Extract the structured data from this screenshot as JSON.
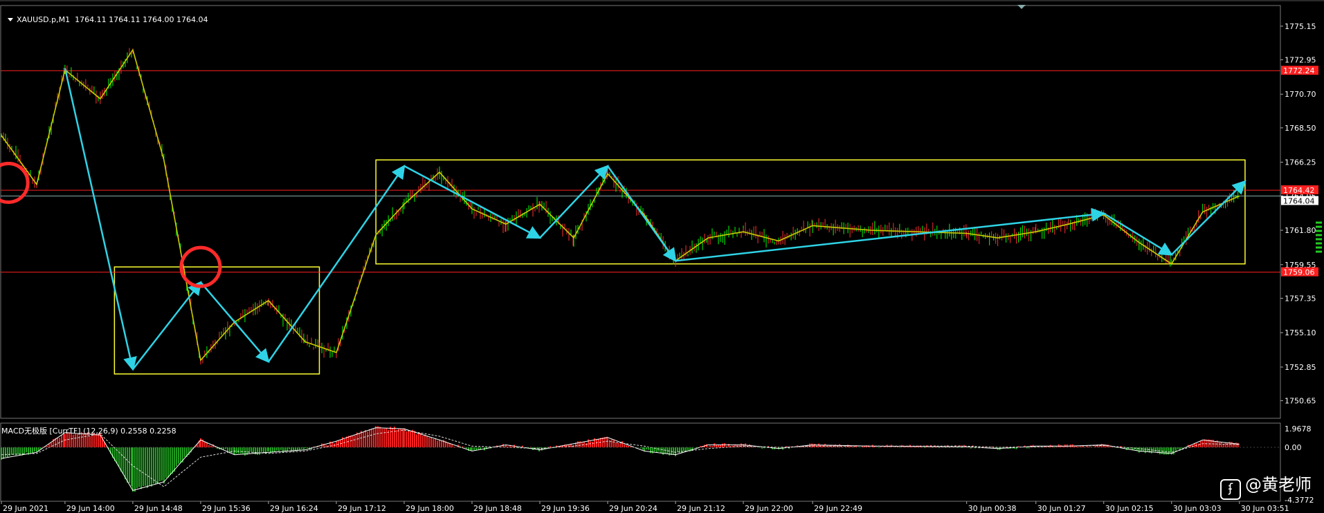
{
  "window": {
    "symbol_label": "XAUUSD.p,M1",
    "ohlc_label": "1764.11 1764.11 1764.00 1764.04"
  },
  "indicator": {
    "label": "MACD无极版 [CurrTF] (12,26,9) 0.2558 0.2258"
  },
  "watermark": {
    "text": "@黄老师"
  },
  "colors": {
    "background": "#000000",
    "price_line": "#cccc00",
    "candle_up": "#00ff00",
    "candle_down": "#ff3030",
    "arrow": "#2fd3e6",
    "zone_box": "#ffff33",
    "level_line": "#ff2020",
    "circle": "#ff2a2a",
    "macd_pos": "#ff2020",
    "macd_neg": "#22aa22",
    "axis_text": "#ffffff"
  },
  "chart_data": [
    {
      "type": "line",
      "name": "XAUUSD.p,M1 price",
      "x": [
        "29 Jun 13:15",
        "29 Jun 13:40",
        "29 Jun 14:00",
        "29 Jun 14:25",
        "29 Jun 14:48",
        "29 Jun 15:10",
        "29 Jun 15:36",
        "29 Jun 16:00",
        "29 Jun 16:24",
        "29 Jun 16:50",
        "29 Jun 17:12",
        "29 Jun 17:40",
        "29 Jun 18:00",
        "29 Jun 18:25",
        "29 Jun 18:48",
        "29 Jun 19:12",
        "29 Jun 19:36",
        "29 Jun 20:00",
        "29 Jun 20:24",
        "29 Jun 20:50",
        "29 Jun 21:12",
        "29 Jun 21:35",
        "29 Jun 22:00",
        "29 Jun 22:25",
        "29 Jun 22:49",
        "29 Jun 23:30",
        "30 Jun 00:38",
        "30 Jun 01:00",
        "30 Jun 01:27",
        "30 Jun 01:50",
        "30 Jun 02:15",
        "30 Jun 02:40",
        "30 Jun 03:03",
        "30 Jun 03:25",
        "30 Jun 03:51"
      ],
      "y": [
        1768.0,
        1764.8,
        1772.3,
        1770.4,
        1773.6,
        1766.4,
        1753.3,
        1755.8,
        1757.2,
        1754.5,
        1753.8,
        1761.5,
        1763.5,
        1765.6,
        1763.2,
        1762.2,
        1763.5,
        1761.3,
        1765.5,
        1762.8,
        1759.8,
        1761.3,
        1761.7,
        1761.1,
        1762.1,
        1761.8,
        1761.6,
        1761.3,
        1761.7,
        1762.2,
        1762.8,
        1761.0,
        1759.6,
        1763.0,
        1764.04
      ],
      "ylim": [
        1749.5,
        1776.5
      ],
      "y_ticks": [
        "1775.15",
        "1772.95",
        "1770.70",
        "1768.50",
        "1766.25",
        "1764.05",
        "1761.80",
        "1759.55",
        "1757.35",
        "1755.10",
        "1752.85",
        "1750.65"
      ],
      "x_ticks": [
        "29 Jun 2021",
        "29 Jun 14:00",
        "29 Jun 14:48",
        "29 Jun 15:36",
        "29 Jun 16:24",
        "29 Jun 17:12",
        "29 Jun 18:00",
        "29 Jun 18:48",
        "29 Jun 19:36",
        "29 Jun 20:24",
        "29 Jun 21:12",
        "29 Jun 22:00",
        "29 Jun 22:49",
        "30 Jun 00:38",
        "30 Jun 01:27",
        "30 Jun 02:15",
        "30 Jun 03:03",
        "30 Jun 03:51"
      ],
      "price_levels": [
        {
          "value": 1772.24,
          "label": "1772.24",
          "color": "#ff2020"
        },
        {
          "value": 1764.42,
          "label": "1764.42",
          "color": "#ff2020"
        },
        {
          "value": 1764.04,
          "label": "1764.04",
          "color": "#ffffff"
        },
        {
          "value": 1759.06,
          "label": "1759.06",
          "color": "#ff2020"
        }
      ],
      "zones": [
        {
          "from": "29 Jun 14:35",
          "to": "29 Jun 17:00",
          "top": 1759.4,
          "bottom": 1752.4
        },
        {
          "from": "29 Jun 17:40",
          "to": "30 Jun 03:55",
          "top": 1766.4,
          "bottom": 1759.6
        }
      ],
      "wave_arrows": [
        {
          "from": {
            "x": "29 Jun 14:00",
            "y": 1772.4
          },
          "to": {
            "x": "29 Jun 14:48",
            "y": 1752.7
          }
        },
        {
          "from": {
            "x": "29 Jun 14:48",
            "y": 1752.7
          },
          "to": {
            "x": "29 Jun 15:36",
            "y": 1758.4
          }
        },
        {
          "from": {
            "x": "29 Jun 15:36",
            "y": 1758.4
          },
          "to": {
            "x": "29 Jun 16:24",
            "y": 1753.2
          }
        },
        {
          "from": {
            "x": "29 Jun 16:24",
            "y": 1753.2
          },
          "to": {
            "x": "29 Jun 18:00",
            "y": 1766.0
          }
        },
        {
          "from": {
            "x": "29 Jun 18:00",
            "y": 1766.0
          },
          "to": {
            "x": "29 Jun 19:36",
            "y": 1761.3
          }
        },
        {
          "from": {
            "x": "29 Jun 19:36",
            "y": 1761.3
          },
          "to": {
            "x": "29 Jun 20:24",
            "y": 1766.0
          }
        },
        {
          "from": {
            "x": "29 Jun 20:24",
            "y": 1766.0
          },
          "to": {
            "x": "29 Jun 21:12",
            "y": 1759.8
          }
        },
        {
          "from": {
            "x": "29 Jun 21:12",
            "y": 1759.8
          },
          "to": {
            "x": "30 Jun 02:15",
            "y": 1762.9
          }
        },
        {
          "from": {
            "x": "30 Jun 02:15",
            "y": 1762.9
          },
          "to": {
            "x": "30 Jun 03:03",
            "y": 1760.2
          }
        },
        {
          "from": {
            "x": "30 Jun 03:03",
            "y": 1760.2
          },
          "to": {
            "x": "30 Jun 03:55",
            "y": 1765.0
          }
        }
      ],
      "circle_marks": [
        {
          "x": "29 Jun 13:20",
          "y": 1764.9
        },
        {
          "x": "29 Jun 15:36",
          "y": 1759.4
        }
      ]
    },
    {
      "type": "bar",
      "name": "MACD无极版 [CurrTF] (12,26,9)",
      "ylim": [
        -4.3772,
        1.9678
      ],
      "y_ticks": [
        "1.9678",
        "0.00",
        "-4.3772"
      ],
      "x": [
        "29 Jun 13:15",
        "29 Jun 13:40",
        "29 Jun 14:00",
        "29 Jun 14:25",
        "29 Jun 14:48",
        "29 Jun 15:10",
        "29 Jun 15:36",
        "29 Jun 16:00",
        "29 Jun 16:24",
        "29 Jun 16:50",
        "29 Jun 17:12",
        "29 Jun 17:40",
        "29 Jun 18:00",
        "29 Jun 18:25",
        "29 Jun 18:48",
        "29 Jun 19:12",
        "29 Jun 19:36",
        "29 Jun 20:00",
        "29 Jun 20:24",
        "29 Jun 20:50",
        "29 Jun 21:12",
        "29 Jun 21:35",
        "29 Jun 22:00",
        "29 Jun 22:25",
        "29 Jun 22:49",
        "29 Jun 23:30",
        "30 Jun 00:38",
        "30 Jun 01:00",
        "30 Jun 01:27",
        "30 Jun 01:50",
        "30 Jun 02:15",
        "30 Jun 02:40",
        "30 Jun 03:03",
        "30 Jun 03:25",
        "30 Jun 03:51"
      ],
      "values": [
        -0.9,
        -0.4,
        1.2,
        1.0,
        -3.5,
        -2.8,
        0.6,
        -0.6,
        -0.4,
        -0.2,
        0.5,
        1.6,
        1.5,
        0.6,
        -0.3,
        0.2,
        -0.2,
        0.3,
        0.8,
        -0.3,
        -0.6,
        0.2,
        0.2,
        -0.1,
        0.2,
        0.1,
        0.05,
        -0.1,
        0.1,
        0.1,
        0.2,
        -0.3,
        -0.5,
        0.6,
        0.2558
      ],
      "signal": [
        -0.6,
        -0.5,
        0.6,
        1.1,
        -1.5,
        -3.2,
        -0.8,
        -0.3,
        -0.5,
        -0.3,
        0.2,
        1.1,
        1.4,
        0.9,
        0.1,
        0.0,
        -0.1,
        0.1,
        0.5,
        0.1,
        -0.4,
        -0.1,
        0.1,
        0.0,
        0.1,
        0.1,
        0.1,
        0.0,
        0.05,
        0.1,
        0.15,
        -0.1,
        -0.4,
        0.3,
        0.2258
      ]
    }
  ]
}
